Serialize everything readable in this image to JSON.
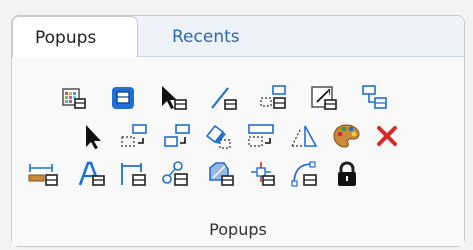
{
  "tabs": [
    {
      "label": "Popups",
      "active": true
    },
    {
      "label": "Recents",
      "active": false
    }
  ],
  "group_label": "Popups",
  "rows": [
    [
      "grid-table-icon",
      "layer-window-icon",
      "select-arrow-icon",
      "line-tool-icon",
      "dimension-split-icon",
      "resize-arrow-icon",
      "hierarchy-icon"
    ],
    [
      "pointer-arrow-icon",
      "stretch-icon",
      "move-icon",
      "eraser-icon",
      "extend-icon",
      "measure-angle-icon",
      "palette-icon",
      "delete-x-icon"
    ],
    [
      "linear-dimension-icon",
      "text-style-icon",
      "bracket-dimension-icon",
      "nodes-icon",
      "shape-fill-icon",
      "crosshair-icon",
      "curve-path-icon",
      "lock-icon"
    ]
  ],
  "colors": {
    "accent": "#2b66b5",
    "delete": "#d62b2b",
    "blue": "#1f6fd6"
  }
}
